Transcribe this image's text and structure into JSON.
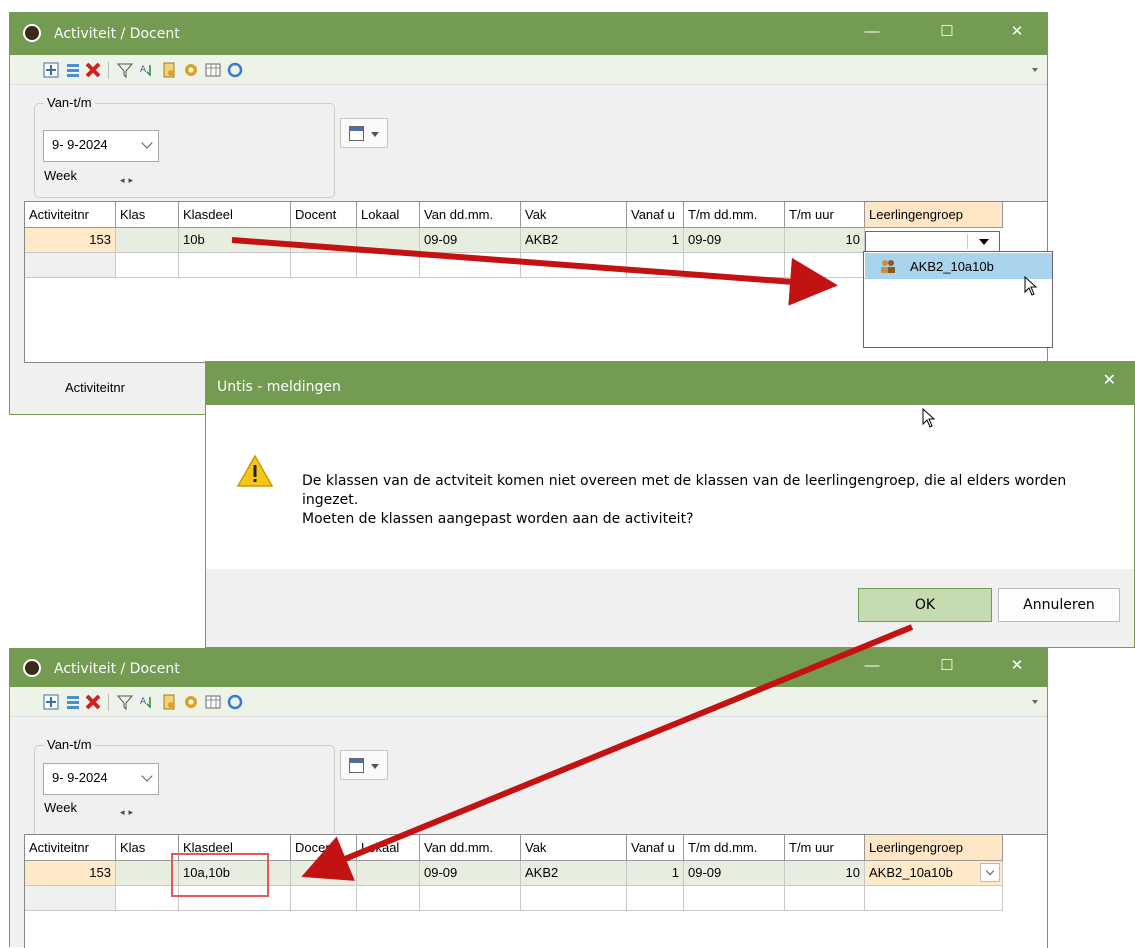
{
  "top_window": {
    "title": "Activiteit / Docent",
    "date_group_label": "Van-t/m",
    "date_value": "9- 9-2024",
    "week_label": "Week",
    "columns": [
      "Activiteitnr",
      "Klas",
      "Klasdeel",
      "Docent",
      "Lokaal",
      "Van dd.mm.",
      "Vak",
      "Vanaf u",
      "T/m dd.mm.",
      "T/m uur",
      "Leerlingengroep"
    ],
    "row": {
      "activiteitnr": "153",
      "klas": "",
      "klasdeel": "10b",
      "docent": "",
      "lokaal": "",
      "van": "09-09",
      "vak": "AKB2",
      "vanaf": "1",
      "tm": "09-09",
      "tmuur": "10",
      "groep": ""
    },
    "bottom_tab": "Activiteitnr",
    "dropdown_item": "AKB2_10a10b"
  },
  "dialog": {
    "title": "Untis - meldingen",
    "message_line1": "De klassen van de actviteit komen niet overeen met de klassen van de leerlingengroep, die al elders worden",
    "message_line2": "ingezet.",
    "message_line3": "Moeten de klassen aangepast worden aan de activiteit?",
    "ok_label": "OK",
    "cancel_label": "Annuleren"
  },
  "bottom_window": {
    "title": "Activiteit / Docent",
    "date_group_label": "Van-t/m",
    "date_value": "9- 9-2024",
    "week_label": "Week",
    "columns": [
      "Activiteitnr",
      "Klas",
      "Klasdeel",
      "Docent",
      "Lokaal",
      "Van dd.mm.",
      "Vak",
      "Vanaf u",
      "T/m dd.mm.",
      "T/m uur",
      "Leerlingengroep"
    ],
    "row": {
      "activiteitnr": "153",
      "klas": "",
      "klasdeel": "10a,10b",
      "docent": "",
      "lokaal": "",
      "van": "09-09",
      "vak": "AKB2",
      "vanaf": "1",
      "tm": "09-09",
      "tmuur": "10",
      "groep": "AKB2_10a10b"
    }
  },
  "colors": {
    "titlebar": "#739b52",
    "arrow": "#c21212",
    "highlight": "#e05a5a"
  }
}
